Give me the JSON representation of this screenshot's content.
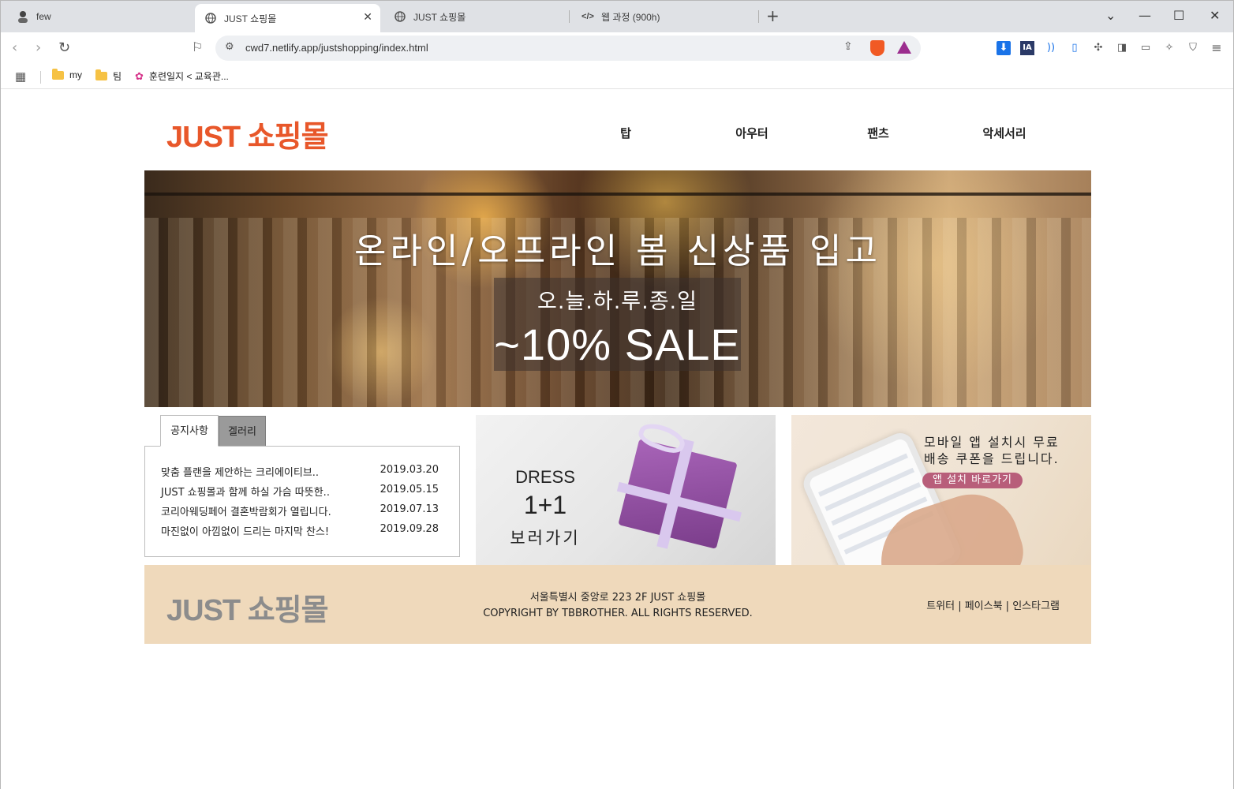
{
  "browser": {
    "tabs": [
      {
        "label": "few"
      },
      {
        "label": "JUST 쇼핑몰"
      },
      {
        "label": "JUST 쇼핑몰"
      },
      {
        "label": "웹 과정 (900h)"
      }
    ],
    "url": "cwd7.netlify.app/justshopping/index.html",
    "bookmarks": [
      "my",
      "팀",
      "훈련일지 < 교육관..."
    ]
  },
  "site": {
    "logo": "JUST 쇼핑몰",
    "menu": [
      "탑",
      "아우터",
      "팬츠",
      "악세서리"
    ]
  },
  "banner": {
    "headline": "온라인/오프라인 봄 신상품 입고",
    "sub": "오.늘.하.루.종.일",
    "sale": "~10% SALE"
  },
  "notice": {
    "tabs": [
      "공지사항",
      "겔러리"
    ],
    "items": [
      {
        "title": "맞춤 플랜을 제안하는 크리에이티브..",
        "date": "2019.03.20"
      },
      {
        "title": "JUST 쇼핑몰과 함께 하실 가슴 따뜻한..",
        "date": "2019.05.15"
      },
      {
        "title": "코리아웨딩페어 결혼박람회가 열립니다.",
        "date": "2019.07.13"
      },
      {
        "title": "마진없이 아낌없이 드리는 마지막 찬스!",
        "date": "2019.09.28"
      }
    ]
  },
  "promo_dress": {
    "line1": "DRESS",
    "line2": "1+1",
    "line3": "보러가기"
  },
  "promo_app": {
    "line1": "모바일 앱 설치시 무료",
    "line2": "배송 쿠폰을 드립니다.",
    "button": "앱 설치 바로가기"
  },
  "footer": {
    "logo": "JUST 쇼핑몰",
    "address": "서울특별시 중앙로 223 2F JUST 쇼핑몰",
    "copyright": "COPYRIGHT BY TBBROTHER. ALL RIGHTS RESERVED.",
    "social": "트위터 | 페이스북 | 인스타그램"
  },
  "colors": {
    "logo": "#e8572a",
    "footer_bg": "#efd9bb",
    "app_button": "#b85e7a"
  }
}
